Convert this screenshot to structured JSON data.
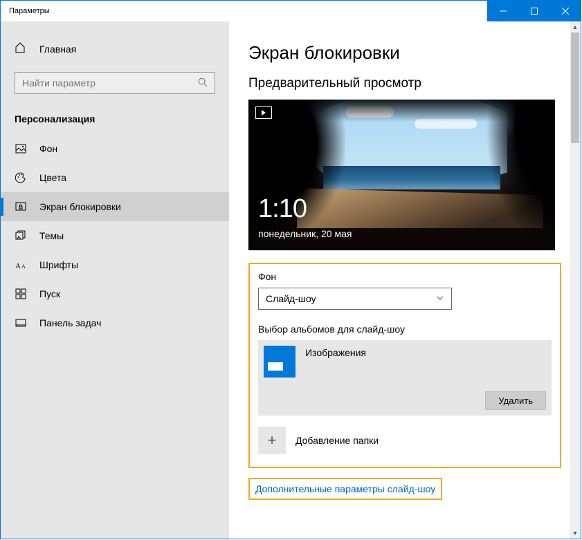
{
  "window": {
    "title": "Параметры"
  },
  "sidebar": {
    "home": "Главная",
    "search_placeholder": "Найти параметр",
    "section": "Персонализация",
    "items": [
      {
        "label": "Фон",
        "icon": "picture-icon"
      },
      {
        "label": "Цвета",
        "icon": "palette-icon"
      },
      {
        "label": "Экран блокировки",
        "icon": "lock-screen-icon",
        "active": true
      },
      {
        "label": "Темы",
        "icon": "themes-icon"
      },
      {
        "label": "Шрифты",
        "icon": "fonts-icon"
      },
      {
        "label": "Пуск",
        "icon": "start-icon"
      },
      {
        "label": "Панель задач",
        "icon": "taskbar-icon"
      }
    ]
  },
  "main": {
    "title": "Экран блокировки",
    "preview_heading": "Предварительный просмотр",
    "preview": {
      "time": "1:10",
      "date": "понедельник, 20 мая"
    },
    "background_label": "Фон",
    "background_value": "Слайд-шоу",
    "albums_label": "Выбор альбомов для слайд-шоу",
    "album_name": "Изображения",
    "delete_label": "Удалить",
    "add_label": "Добавление папки",
    "advanced_link": "Дополнительные параметры слайд-шоу"
  }
}
